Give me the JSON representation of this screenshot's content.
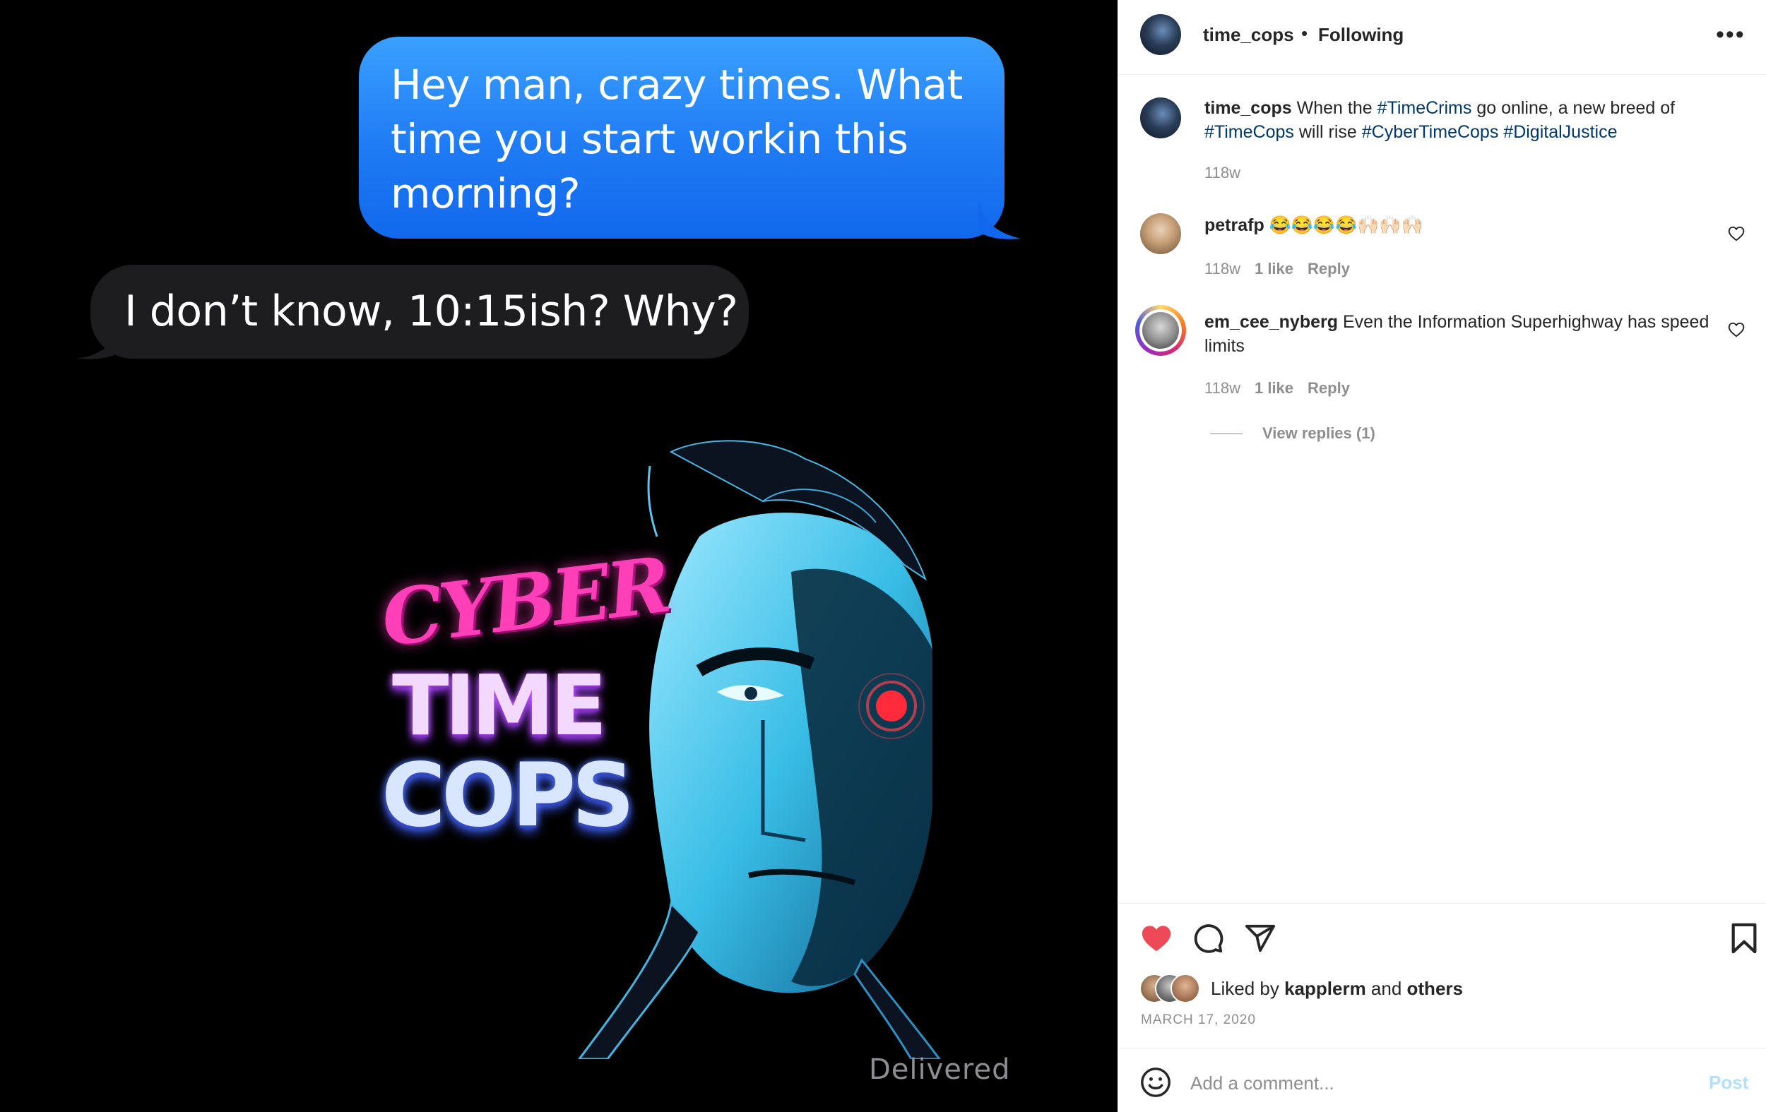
{
  "media": {
    "sent_message": "Hey man, crazy times. What time you start workin this morning?",
    "received_message": "I don’t know, 10:15ish? Why?",
    "status": "Delivered",
    "artwork": {
      "line1": "CYBER",
      "line2": "TIME",
      "line3": "COPS"
    }
  },
  "header": {
    "username": "time_cops",
    "separator": "•",
    "follow_state": "Following",
    "more_icon": "more-horizontal-icon"
  },
  "caption": {
    "username": "time_cops",
    "text_before": " When the ",
    "tag1": "#TimeCrims",
    "text_mid": " go online, a new breed of ",
    "tag2": "#TimeCops",
    "text_mid2": " will rise ",
    "tag3": "#CyberTimeCops",
    "text_space": " ",
    "tag4": "#DigitalJustice",
    "age": "118w"
  },
  "comments": [
    {
      "username": "petrafp",
      "text": " 😂😂😂😂🙌🏻🙌🏻🙌🏻",
      "age": "118w",
      "likes": "1 like",
      "reply": "Reply"
    },
    {
      "username": "em_cee_nyberg",
      "text": " Even the Information Superhighway has speed limits",
      "age": "118w",
      "likes": "1 like",
      "reply": "Reply",
      "view_replies": "View replies (1)"
    }
  ],
  "actions": {
    "liked": true,
    "like_color": "#ed4956",
    "liked_by_prefix": "Liked by ",
    "liked_by_user": "kapplerm",
    "liked_by_and": " and ",
    "liked_by_others": "others",
    "date": "MARCH 17, 2020"
  },
  "comment_box": {
    "placeholder": "Add a comment...",
    "post_label": "Post"
  },
  "colors": {
    "sent_bubble": "#1f7bf4",
    "received_bubble": "#1d1d1f",
    "hashtag": "#00376b",
    "post_disabled": "#b2dffc"
  }
}
